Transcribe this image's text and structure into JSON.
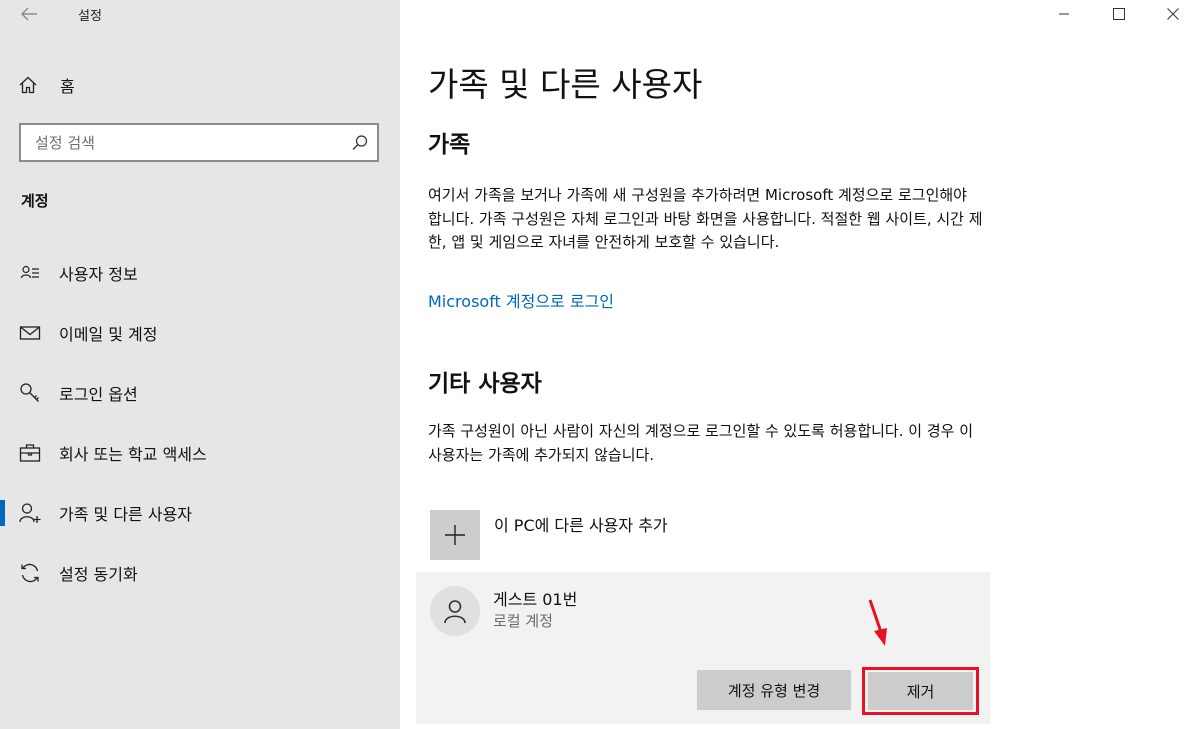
{
  "window": {
    "title": "설정"
  },
  "sidebar": {
    "home_label": "홈",
    "search_placeholder": "설정 검색",
    "section_label": "계정",
    "items": [
      {
        "label": "사용자 정보",
        "icon": "user-info-icon"
      },
      {
        "label": "이메일 및 계정",
        "icon": "mail-icon"
      },
      {
        "label": "로그인 옵션",
        "icon": "key-icon"
      },
      {
        "label": "회사 또는 학교 액세스",
        "icon": "briefcase-icon"
      },
      {
        "label": "가족 및 다른 사용자",
        "icon": "add-person-icon",
        "active": true
      },
      {
        "label": "설정 동기화",
        "icon": "sync-icon"
      }
    ]
  },
  "main": {
    "title": "가족 및 다른 사용자",
    "family": {
      "heading": "가족",
      "description": "여기서 가족을 보거나 가족에 새 구성원을 추가하려면 Microsoft 계정으로 로그인해야 합니다. 가족 구성원은 자체 로그인과 바탕 화면을 사용합니다. 적절한 웹 사이트, 시간 제한, 앱 및 게임으로 자녀를 안전하게 보호할 수 있습니다.",
      "link": "Microsoft 계정으로 로그인"
    },
    "other_users": {
      "heading": "기타 사용자",
      "description": "가족 구성원이 아닌 사람이 자신의 계정으로 로그인할 수 있도록 허용합니다. 이 경우 이 사용자는 가족에 추가되지 않습니다.",
      "add_label": "이 PC에 다른 사용자 추가",
      "user": {
        "name": "게스트 01번",
        "type": "로컬 계정",
        "change_type_button": "계정 유형 변경",
        "remove_button": "제거"
      }
    }
  },
  "colors": {
    "accent": "#0067c0",
    "highlight": "#e81123",
    "sidebar_bg": "#e6e6e6"
  }
}
